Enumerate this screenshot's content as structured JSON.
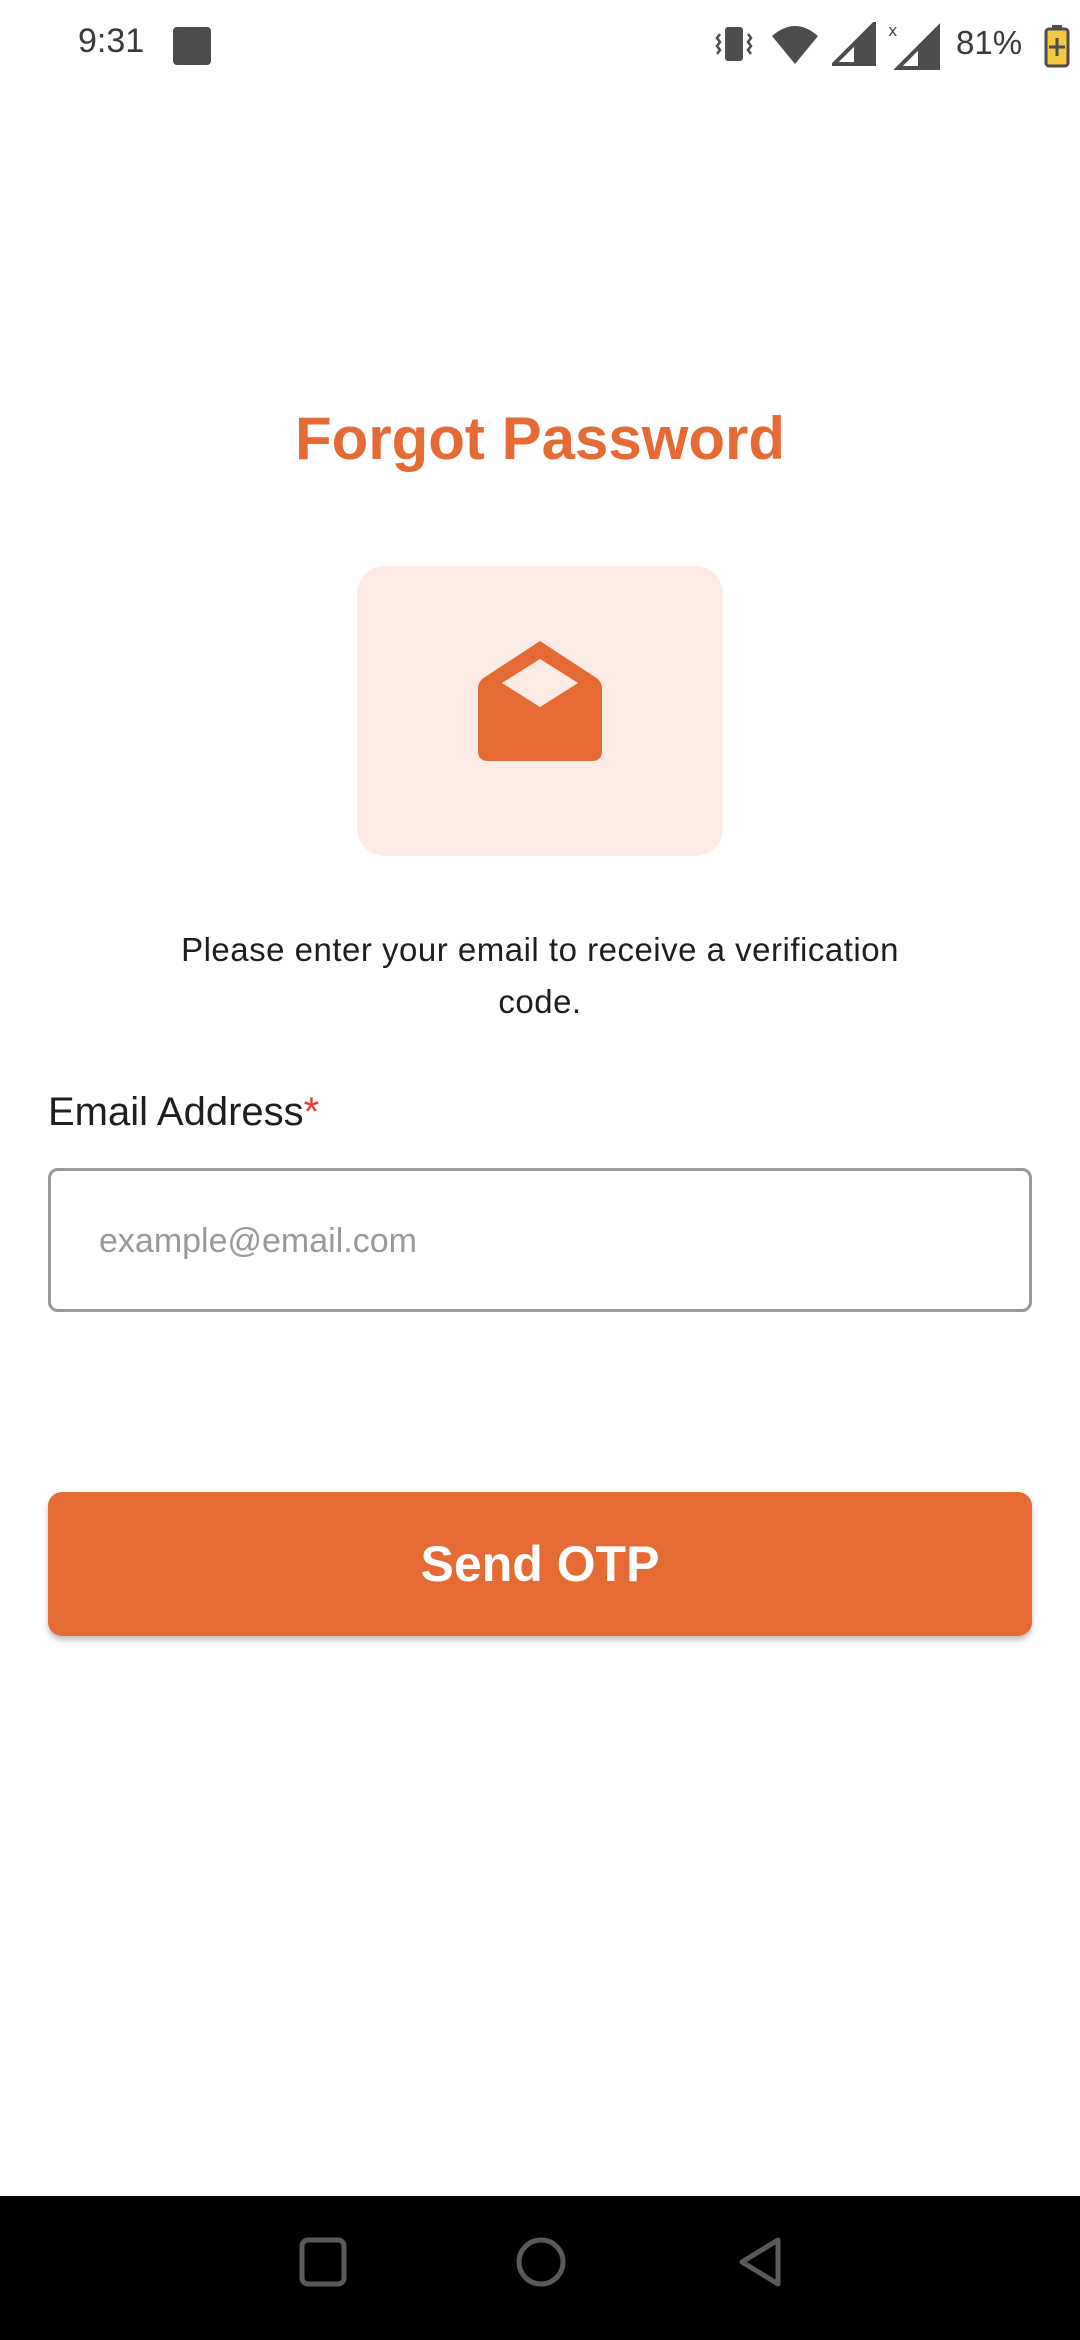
{
  "status_bar": {
    "time": "9:31",
    "battery": "81%",
    "icons": [
      "app-notification-icon",
      "vibrate-icon",
      "wifi-icon",
      "signal-icon",
      "signal-no-service-icon",
      "battery-charging-icon"
    ]
  },
  "screen": {
    "title": "Forgot Password",
    "icon": "open-envelope-icon",
    "description": "Please enter your email to receive a verification code."
  },
  "form": {
    "email_label": "Email Address",
    "required_mark": "*",
    "email_value": "",
    "email_placeholder": "example@email.com",
    "submit_label": "Send OTP"
  },
  "nav_bar": {
    "buttons": [
      "recents-icon",
      "home-icon",
      "back-icon"
    ]
  },
  "colors": {
    "accent": "#e66a33",
    "icon_bg": "#fdece6",
    "required": "#e53935"
  }
}
